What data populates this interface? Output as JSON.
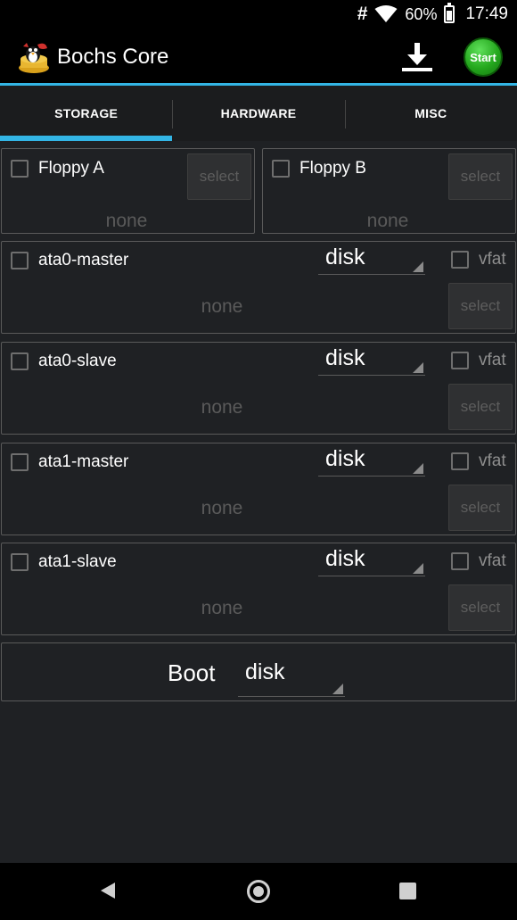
{
  "status_bar": {
    "network_symbol": "#",
    "battery_percent": "60%",
    "time": "17:49",
    "icons": [
      "hash-icon",
      "wifi-icon",
      "battery-icon"
    ]
  },
  "action_bar": {
    "title": "Bochs Core",
    "start_label": "Start",
    "icons": [
      "app-logo-icon",
      "download-icon"
    ],
    "accent_color": "#33b5e5",
    "start_color": "#25a81e"
  },
  "tabs": [
    {
      "label": "STORAGE",
      "selected": true
    },
    {
      "label": "HARDWARE",
      "selected": false
    },
    {
      "label": "MISC",
      "selected": false
    }
  ],
  "floppies": [
    {
      "label": "Floppy A",
      "checked": false,
      "select_label": "select",
      "value": "none"
    },
    {
      "label": "Floppy B",
      "checked": false,
      "select_label": "select",
      "value": "none"
    }
  ],
  "ata_drives": [
    {
      "label": "ata0-master",
      "checked": false,
      "type": "disk",
      "vfat_label": "vfat",
      "vfat_checked": false,
      "select_label": "select",
      "value": "none"
    },
    {
      "label": "ata0-slave",
      "checked": false,
      "type": "disk",
      "vfat_label": "vfat",
      "vfat_checked": false,
      "select_label": "select",
      "value": "none"
    },
    {
      "label": "ata1-master",
      "checked": false,
      "type": "disk",
      "vfat_label": "vfat",
      "vfat_checked": false,
      "select_label": "select",
      "value": "none"
    },
    {
      "label": "ata1-slave",
      "checked": false,
      "type": "disk",
      "vfat_label": "vfat",
      "vfat_checked": false,
      "select_label": "select",
      "value": "none"
    }
  ],
  "boot": {
    "label": "Boot",
    "value": "disk"
  },
  "nav_bar": {
    "icons": [
      "back-icon",
      "home-icon",
      "recents-icon"
    ]
  }
}
